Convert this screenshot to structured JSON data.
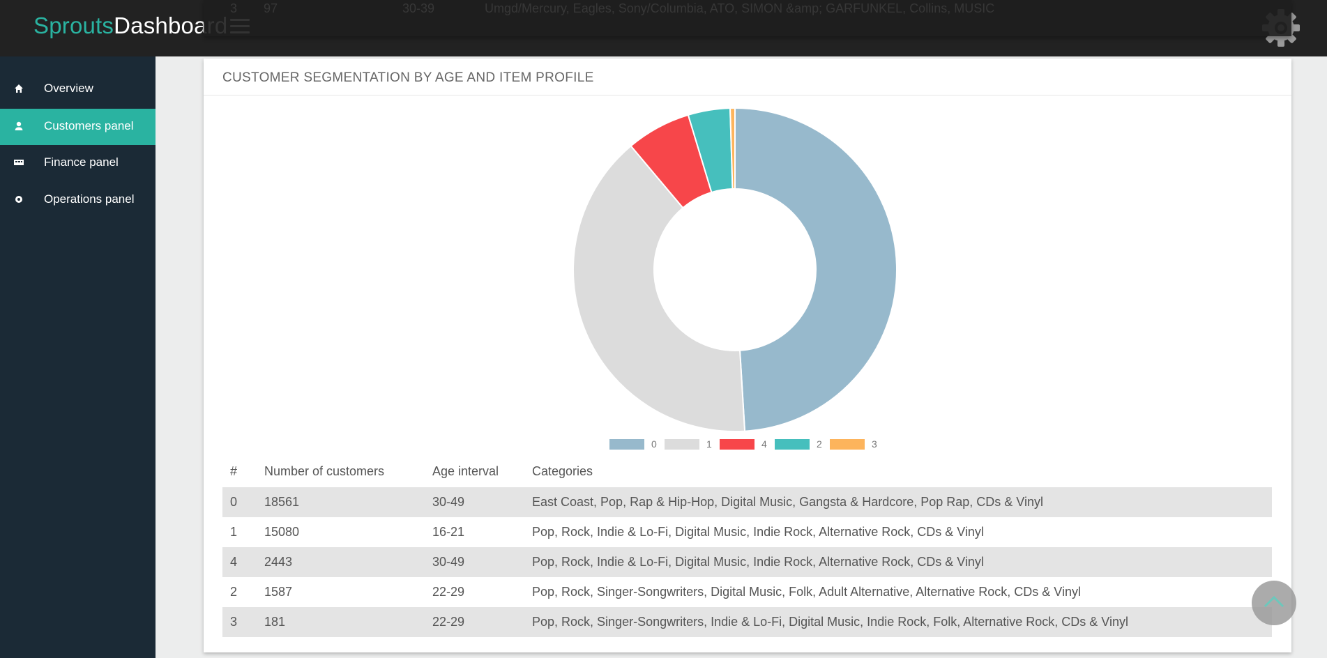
{
  "brand": {
    "part1": "Sprouts",
    "part2": "Dashboard"
  },
  "behind_row": {
    "num": "3",
    "count": "97",
    "age": "30-39",
    "text": "Umgd/Mercury, Eagles, Sony/Columbia, ATO, SIMON &amp; GARFUNKEL, Collins, MUSIC"
  },
  "sidebar": {
    "items": [
      {
        "label": "Overview",
        "icon": "home-icon"
      },
      {
        "label": "Customers panel",
        "icon": "user-icon"
      },
      {
        "label": "Finance panel",
        "icon": "money-icon"
      },
      {
        "label": "Operations panel",
        "icon": "gear-small-icon"
      }
    ],
    "active_index": 1
  },
  "panel": {
    "title": "CUSTOMER SEGMENTATION BY AGE AND ITEM PROFILE"
  },
  "chart_data": {
    "type": "pie",
    "donut": true,
    "categories": [
      "0",
      "1",
      "4",
      "2",
      "3"
    ],
    "values": [
      18561,
      15080,
      2443,
      1587,
      181
    ],
    "colors": [
      "#97b9cc",
      "#dcdcdc",
      "#f7464a",
      "#46bfbd",
      "#fdb45c"
    ],
    "legend_position": "bottom"
  },
  "table": {
    "headers": [
      "#",
      "Number of customers",
      "Age interval",
      "Categories"
    ],
    "rows": [
      [
        "0",
        "18561",
        "30-49",
        "East Coast, Pop, Rap & Hip-Hop, Digital Music, Gangsta & Hardcore, Pop Rap, CDs & Vinyl"
      ],
      [
        "1",
        "15080",
        "16-21",
        "Pop, Rock, Indie & Lo-Fi, Digital Music, Indie Rock, Alternative Rock, CDs & Vinyl"
      ],
      [
        "4",
        "2443",
        "30-49",
        "Pop, Rock, Indie & Lo-Fi, Digital Music, Indie Rock, Alternative Rock, CDs & Vinyl"
      ],
      [
        "2",
        "1587",
        "22-29",
        "Pop, Rock, Singer-Songwriters, Digital Music, Folk, Adult Alternative, Alternative Rock, CDs & Vinyl"
      ],
      [
        "3",
        "181",
        "22-29",
        "Pop, Rock, Singer-Songwriters, Indie & Lo-Fi, Digital Music, Indie Rock, Folk, Alternative Rock, CDs & Vinyl"
      ]
    ]
  },
  "colors": {
    "accent": "#2ab3a1",
    "sidebar_bg": "#1b2a36",
    "topbar_bg": "#222222"
  }
}
